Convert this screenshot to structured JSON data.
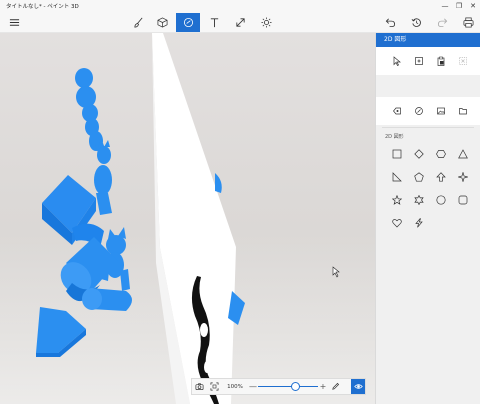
{
  "window": {
    "title": "タイトルなし* - ペイント 3D",
    "minimize_glyph": "—",
    "maximize_glyph": "❐",
    "close_glyph": "✕"
  },
  "toolbar": {
    "items": [
      {
        "name": "menu",
        "icon": "hamburger-icon"
      },
      {
        "name": "brushes",
        "icon": "brush-icon"
      },
      {
        "name": "3d-shapes",
        "icon": "cube-icon"
      },
      {
        "name": "2d-shapes",
        "icon": "shapes-2d-icon",
        "active": true
      },
      {
        "name": "text",
        "icon": "text-icon"
      },
      {
        "name": "canvas",
        "icon": "canvas-resize-icon"
      },
      {
        "name": "effects",
        "icon": "sun-icon"
      },
      {
        "name": "undo",
        "icon": "undo-icon"
      },
      {
        "name": "history",
        "icon": "history-icon"
      },
      {
        "name": "redo",
        "icon": "redo-icon"
      },
      {
        "name": "print",
        "icon": "print-icon"
      }
    ]
  },
  "panel": {
    "header": "2D 図形",
    "section_label": "2D 図形",
    "tools_row": [
      "select-icon",
      "add-point-icon",
      "paste-icon",
      "delete-icon"
    ],
    "actions_row": [
      "sticker-icon",
      "brush-tool-icon",
      "image-icon",
      "folder-icon"
    ],
    "shapes": [
      "square-icon",
      "diamond-icon",
      "hexagon-icon",
      "triangle-icon",
      "right-triangle-icon",
      "pentagon-icon",
      "arrow-up-icon",
      "star4-icon",
      "star5-icon",
      "star6-icon",
      "circle-icon",
      "rounded-square-icon",
      "heart-icon",
      "lightning-icon"
    ]
  },
  "zoom": {
    "percent_label": "100%",
    "minus": "—",
    "plus": "+",
    "level_fraction": 0.62
  },
  "colors": {
    "accent": "#1f6fd0",
    "model_blue": "#2b8ff0"
  }
}
